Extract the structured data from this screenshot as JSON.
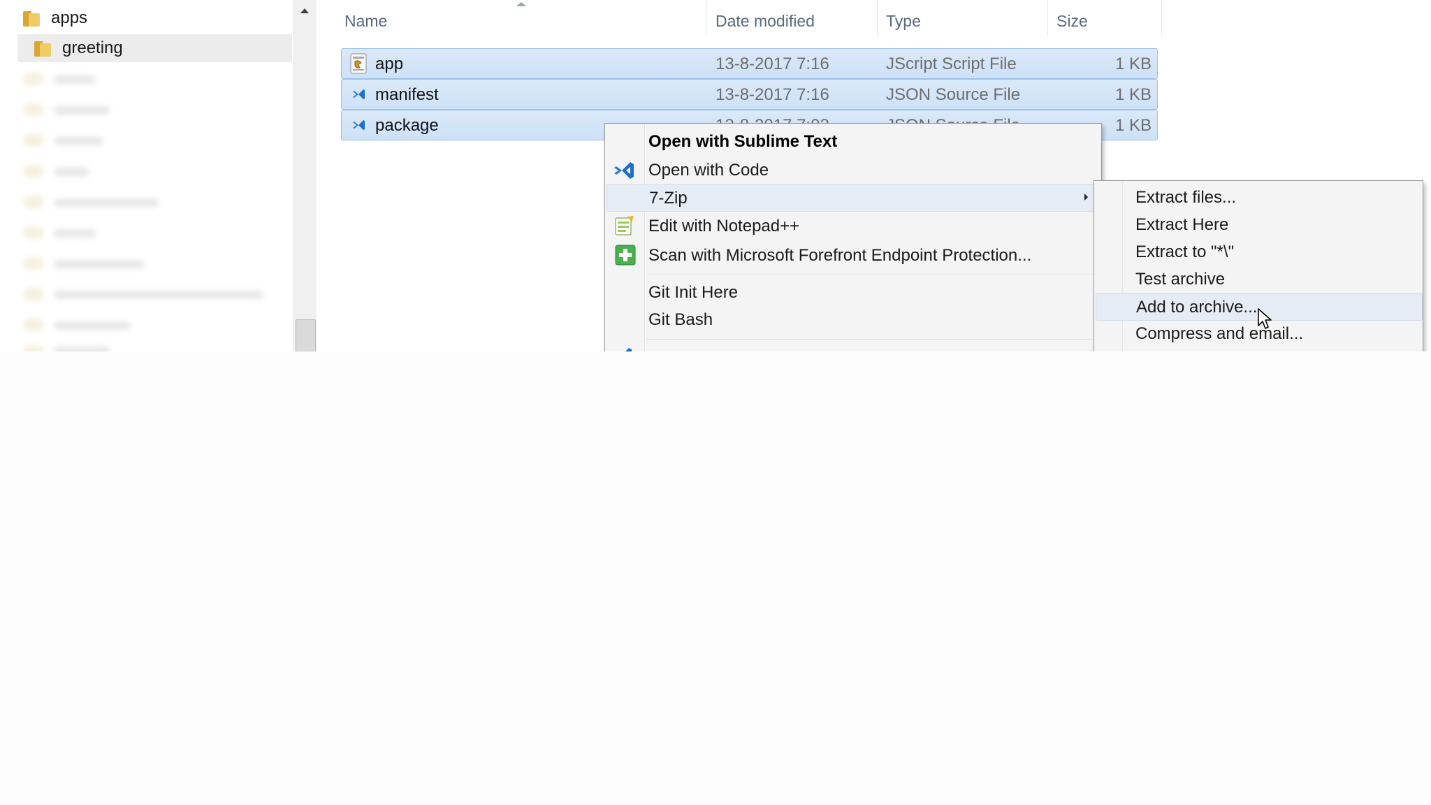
{
  "navigation_pane": {
    "items": [
      {
        "label": "apps"
      },
      {
        "label": "greeting"
      }
    ]
  },
  "file_list": {
    "columns": {
      "name": "Name",
      "date_modified": "Date modified",
      "type": "Type",
      "size": "Size"
    },
    "rows": [
      {
        "name": "app",
        "date": "13-8-2017 7:16",
        "type": "JScript Script File",
        "size": "1 KB",
        "icon": "jscript-file-icon"
      },
      {
        "name": "manifest",
        "date": "13-8-2017 7:16",
        "type": "JSON Source File",
        "size": "1 KB",
        "icon": "vscode-file-icon"
      },
      {
        "name": "package",
        "date": "13-8-2017 7:03",
        "type": "JSON Source File",
        "size": "1 KB",
        "icon": "vscode-file-icon"
      }
    ]
  },
  "context_menu": {
    "items": [
      {
        "label": "Open with Sublime Text",
        "icon": "",
        "bold": true
      },
      {
        "label": "Open with Code",
        "icon": "vscode-icon"
      },
      {
        "label": "7-Zip",
        "icon": "",
        "has_submenu": true,
        "highlighted": true
      },
      {
        "label": "Edit with Notepad++",
        "icon": "notepad-plus-plus-icon"
      },
      {
        "label": "Scan with Microsoft Forefront Endpoint Protection...",
        "icon": "forefront-shield-icon"
      },
      {
        "label": "Git Init Here",
        "icon": ""
      },
      {
        "label": "Git Bash",
        "icon": ""
      }
    ]
  },
  "submenu_7zip": {
    "items": [
      {
        "label": "Extract files..."
      },
      {
        "label": "Extract Here"
      },
      {
        "label": "Extract to \"*\\\""
      },
      {
        "label": "Test archive"
      },
      {
        "label": "Add to archive...",
        "highlighted": true
      },
      {
        "label": "Compress and email..."
      }
    ]
  },
  "colors": {
    "selection_fill": "#cde1f7",
    "selection_border": "#9dc1e8",
    "menu_background": "#f4f4f4",
    "header_text": "#596a7f",
    "folder_yellow": "#f1cc65",
    "vscode_blue": "#1e6fc9"
  }
}
